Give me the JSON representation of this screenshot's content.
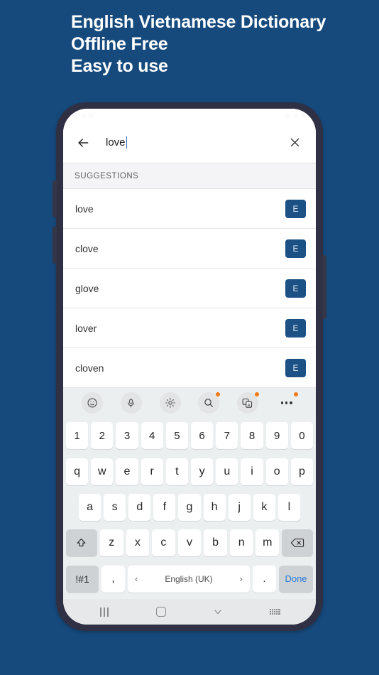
{
  "promo": {
    "line1": "English Vietnamese Dictionary",
    "line2": "Offline Free",
    "line3": "Easy to use",
    "background_color": "#164a7d",
    "text_color": "#ffffff"
  },
  "statusbar": {
    "time": ""
  },
  "search": {
    "back_icon": "back-arrow-icon",
    "value": "love",
    "clear_icon": "close-icon"
  },
  "suggestions": {
    "header": "SUGGESTIONS",
    "badge_color": "#1b5184",
    "items": [
      {
        "word": "love",
        "lang": "E"
      },
      {
        "word": "clove",
        "lang": "E"
      },
      {
        "word": "glove",
        "lang": "E"
      },
      {
        "word": "lover",
        "lang": "E"
      },
      {
        "word": "cloven",
        "lang": "E"
      }
    ]
  },
  "keyboard": {
    "background_color": "#eceff0",
    "badge_dot_color": "#f07a17",
    "toolbar": [
      {
        "name": "emoji-icon",
        "has_badge": false
      },
      {
        "name": "microphone-icon",
        "has_badge": false
      },
      {
        "name": "settings-gear-icon",
        "has_badge": false
      },
      {
        "name": "search-icon",
        "has_badge": true
      },
      {
        "name": "translate-icon",
        "has_badge": true
      },
      {
        "name": "more-options-icon",
        "has_badge": true
      }
    ],
    "row_numbers": [
      "1",
      "2",
      "3",
      "4",
      "5",
      "6",
      "7",
      "8",
      "9",
      "0"
    ],
    "row_top": [
      "q",
      "w",
      "e",
      "r",
      "t",
      "y",
      "u",
      "i",
      "o",
      "p"
    ],
    "row_home": [
      "a",
      "s",
      "d",
      "f",
      "g",
      "h",
      "j",
      "k",
      "l"
    ],
    "row_bottom": [
      "z",
      "x",
      "c",
      "v",
      "b",
      "n",
      "m"
    ],
    "shift_label": "shift-icon",
    "backspace_label": "backspace-icon",
    "symbols_label": "!#1",
    "comma_label": ",",
    "period_label": ".",
    "space_label": "English (UK)",
    "space_prev": "‹",
    "space_next": "›",
    "done_label": "Done",
    "done_color": "#2a7ad4"
  },
  "navbar": {
    "recents": "recents-icon",
    "home": "home-icon",
    "hide_keyboard": "chevron-down-icon",
    "keyboard_switch": "keyboard-icon"
  }
}
